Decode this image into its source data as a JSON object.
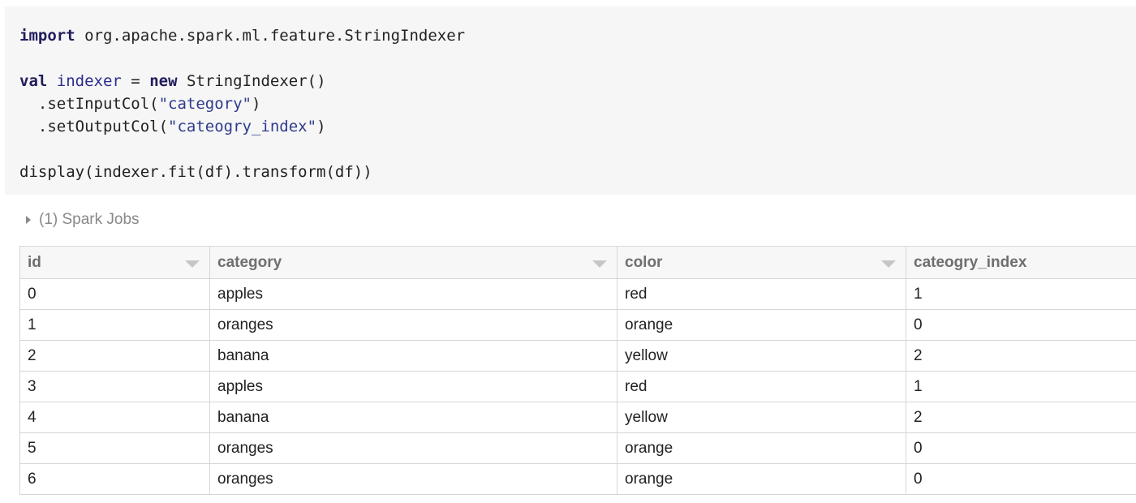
{
  "code": {
    "lines": [
      [
        {
          "t": "import",
          "c": "kw"
        },
        {
          "t": " org.apache.spark.ml.feature.StringIndexer",
          "c": ""
        }
      ],
      [],
      [
        {
          "t": "val",
          "c": "kw"
        },
        {
          "t": " ",
          "c": ""
        },
        {
          "t": "indexer",
          "c": "var"
        },
        {
          "t": " = ",
          "c": ""
        },
        {
          "t": "new",
          "c": "kw"
        },
        {
          "t": " StringIndexer()",
          "c": ""
        }
      ],
      [
        {
          "t": "  .setInputCol(",
          "c": ""
        },
        {
          "t": "\"category\"",
          "c": "str"
        },
        {
          "t": ")",
          "c": ""
        }
      ],
      [
        {
          "t": "  .setOutputCol(",
          "c": ""
        },
        {
          "t": "\"cateogry_index\"",
          "c": "str"
        },
        {
          "t": ")",
          "c": ""
        }
      ],
      [],
      [
        {
          "t": "display(indexer.fit(df).transform(df))",
          "c": ""
        }
      ]
    ]
  },
  "output": {
    "jobs_label": "(1) Spark Jobs"
  },
  "table": {
    "columns": [
      "id",
      "category",
      "color",
      "cateogry_index"
    ],
    "rows": [
      [
        "0",
        "apples",
        "red",
        "1"
      ],
      [
        "1",
        "oranges",
        "orange",
        "0"
      ],
      [
        "2",
        "banana",
        "yellow",
        "2"
      ],
      [
        "3",
        "apples",
        "red",
        "1"
      ],
      [
        "4",
        "banana",
        "yellow",
        "2"
      ],
      [
        "5",
        "oranges",
        "orange",
        "0"
      ],
      [
        "6",
        "oranges",
        "orange",
        "0"
      ]
    ]
  },
  "colors": {
    "keyword": "#211d5a",
    "identifier": "#2b2b8f",
    "string": "#2e3a8c",
    "code_background": "#f6f6f7"
  }
}
